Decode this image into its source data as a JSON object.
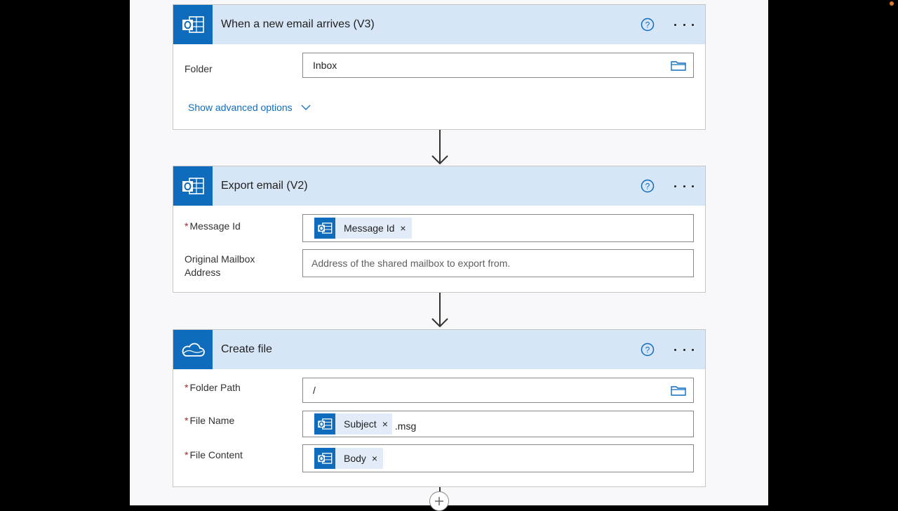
{
  "flow": {
    "trigger": {
      "title": "When a new email arrives (V3)",
      "icon": "outlook-icon",
      "folder_label": "Folder",
      "folder_value": "Inbox",
      "advanced_label": "Show advanced options"
    },
    "export": {
      "title": "Export email (V2)",
      "icon": "outlook-icon",
      "message_id_label": "Message Id",
      "message_id_token": "Message Id",
      "mailbox_label_line1": "Original Mailbox",
      "mailbox_label_line2": "Address",
      "mailbox_placeholder": "Address of the shared mailbox to export from."
    },
    "create": {
      "title": "Create file",
      "icon": "onedrive-icon",
      "folder_path_label": "Folder Path",
      "folder_path_value": "/",
      "file_name_label": "File Name",
      "file_name_token": "Subject",
      "file_name_suffix": ".msg",
      "file_content_label": "File Content",
      "file_content_token": "Body"
    },
    "required_mark": "*",
    "token_close": "×"
  },
  "colors": {
    "accent": "#0f6cbd",
    "header_bg": "#d6e6f7",
    "required": "#a4262c"
  }
}
